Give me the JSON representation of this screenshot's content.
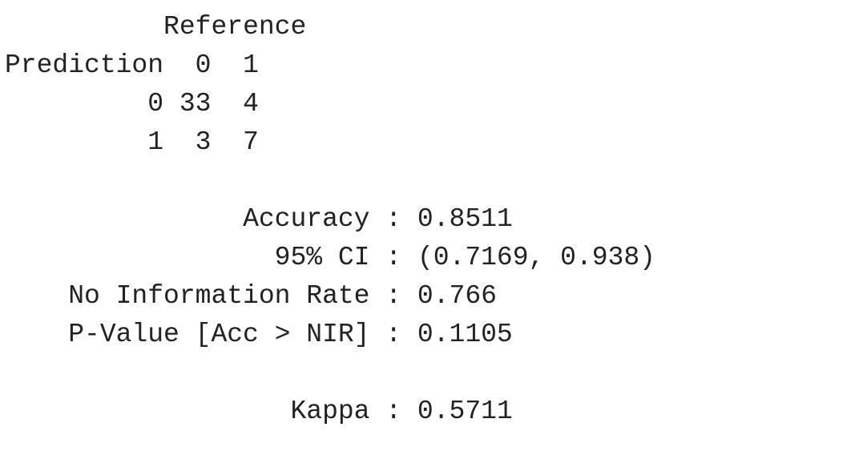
{
  "confusion_matrix": {
    "reference_label": "Reference",
    "prediction_label": "Prediction",
    "columns": [
      "0",
      "1"
    ],
    "rows": [
      {
        "label": "0",
        "values": [
          "33",
          "4"
        ]
      },
      {
        "label": "1",
        "values": [
          "3",
          "7"
        ]
      }
    ]
  },
  "statistics": [
    {
      "label": "Accuracy",
      "value": "0.8511"
    },
    {
      "label": "95% CI",
      "value": "(0.7169, 0.938)"
    },
    {
      "label": "No Information Rate",
      "value": "0.766"
    },
    {
      "label": "P-Value [Acc > NIR]",
      "value": "0.1105"
    }
  ],
  "kappa": {
    "label": "Kappa",
    "value": "0.5711"
  },
  "separator": " : "
}
